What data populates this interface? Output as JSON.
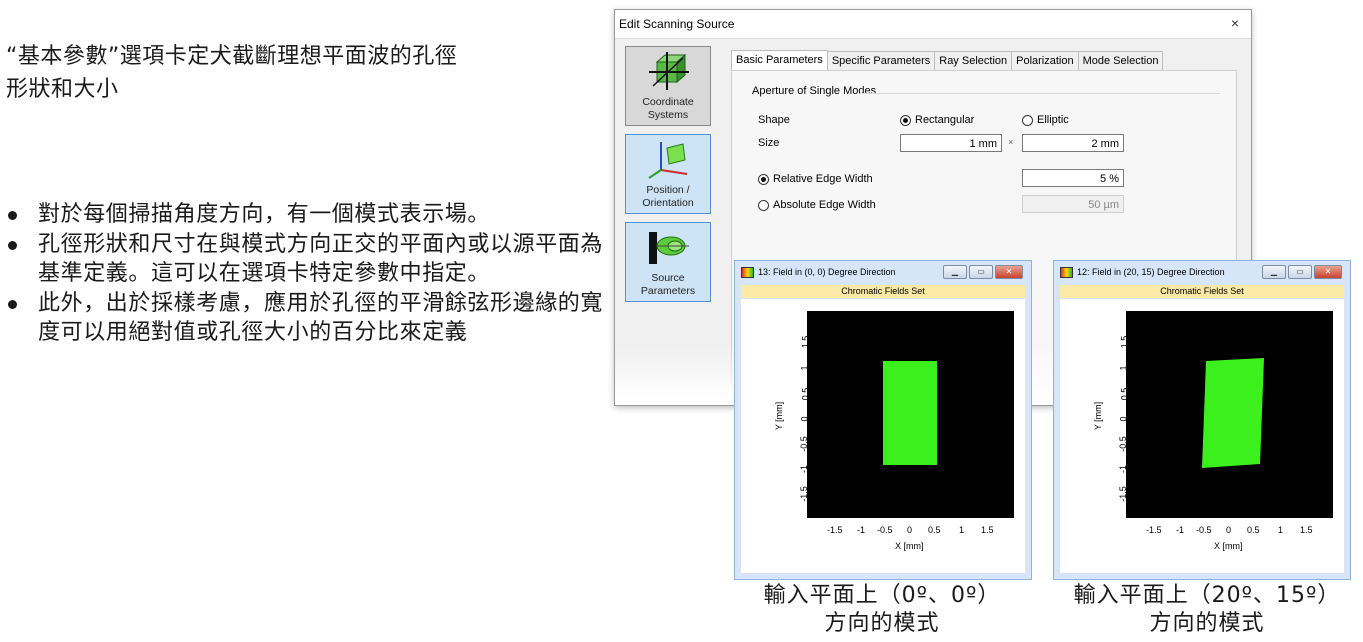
{
  "slide": {
    "intro": "“基本參數”選項卡定犬截斷理想平面波的孔徑形狀和大小",
    "bullets": [
      "對於每個掃描角度方向，有一個模式表示場。",
      "孔徑形狀和尺寸在與模式方向正交的平面內或以源平面為基準定義。這可以在選項卡特定參數中指定。",
      "此外，出於採樣考慮，應用於孔徑的平滑餘弦形邊緣的寬度可以用絕對值或孔徑大小的百分比來定義"
    ]
  },
  "dialog": {
    "title": "Edit Scanning Source",
    "close": "×",
    "sidebar": [
      {
        "label": "Coordinate Systems",
        "icon": "coordinate-systems-icon"
      },
      {
        "label": "Position / Orientation",
        "icon": "position-orientation-icon"
      },
      {
        "label": "Source Parameters",
        "icon": "source-parameters-icon"
      }
    ],
    "tabs": [
      "Basic Parameters",
      "Specific Parameters",
      "Ray Selection",
      "Polarization",
      "Mode Selection"
    ],
    "group_title": "Aperture of Single Modes",
    "shape_label": "Shape",
    "shape_options": [
      "Rectangular",
      "Elliptic"
    ],
    "size_label": "Size",
    "size_x": "1 mm",
    "size_sep": "×",
    "size_y": "2 mm",
    "edge_options": [
      "Relative Edge Width",
      "Absolute Edge Width"
    ],
    "relative_value": "5 %",
    "absolute_value": "50 µm"
  },
  "windows": [
    {
      "title": "13: Field in (0, 0) Degree Direction",
      "subtitle": "Chromatic Fields Set",
      "xlabel": "X [mm]",
      "ylabel": "Y [mm]",
      "xticks": [
        "-1.5",
        "-1",
        "-0.5",
        "0",
        "0.5",
        "1",
        "1.5"
      ],
      "yticks": [
        "1.5",
        "1",
        "0.5",
        "0",
        "-0.5",
        "-1",
        "-1.5"
      ],
      "caption_line1": "輸入平面上（0º、0º）",
      "caption_line2": "方向的模式"
    },
    {
      "title": "12: Field in (20, 15) Degree Direction",
      "subtitle": "Chromatic Fields Set",
      "xlabel": "X [mm]",
      "ylabel": "Y [mm]",
      "xticks": [
        "-1.5",
        "-1",
        "-0.5",
        "0",
        "0.5",
        "1",
        "1.5"
      ],
      "yticks": [
        "1.5",
        "1",
        "0.5",
        "0",
        "-0.5",
        "-1",
        "-1.5"
      ],
      "caption_line1": "輸入平面上（20º、15º）",
      "caption_line2": "方向的模式"
    }
  ],
  "colors": {
    "field": "#3cf01e",
    "plot_bg": "#000000",
    "window_frame": "#d6e6f8",
    "highlight": "#cde4f7"
  }
}
